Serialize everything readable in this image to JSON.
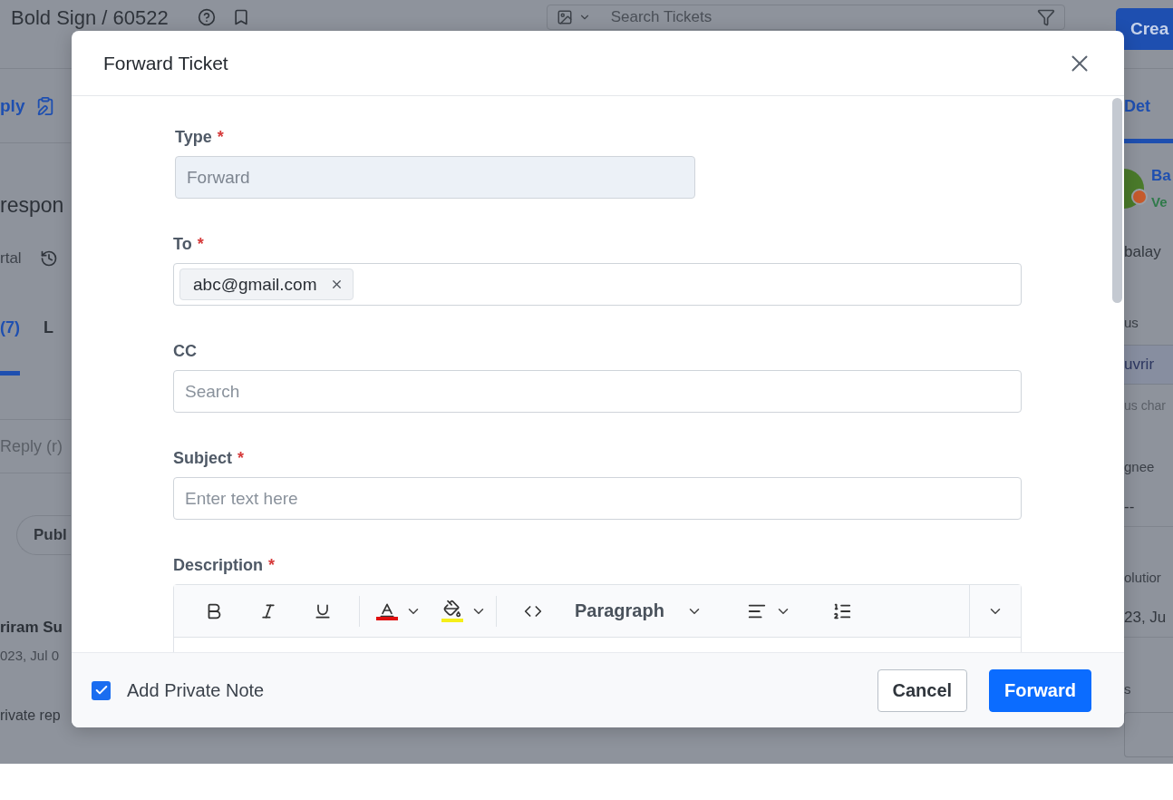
{
  "background": {
    "breadcrumb": "Bold Sign / 60522",
    "search": {
      "placeholder": "Search Tickets"
    },
    "create_button": "Crea",
    "left_items": [
      {
        "kind": "link",
        "text": "ply"
      },
      {
        "kind": "heading",
        "text": "respon"
      },
      {
        "kind": "meta",
        "text": "rtal"
      },
      {
        "kind": "tabs",
        "items": [
          {
            "text": "(7)",
            "selected": true
          },
          {
            "text": "L",
            "selected": false
          }
        ]
      },
      {
        "kind": "field",
        "text": "Reply (r)"
      },
      {
        "kind": "pill",
        "text": "Publ"
      },
      {
        "kind": "name",
        "text": "riram Su"
      },
      {
        "kind": "date",
        "text": "023, Jul 0"
      },
      {
        "kind": "text",
        "text": "rivate rep"
      }
    ],
    "right_items": [
      {
        "kind": "tab",
        "text": "Det",
        "selected": true
      },
      {
        "kind": "contact",
        "name": "Ba",
        "status": "Ve"
      },
      {
        "kind": "text",
        "text": "balay"
      },
      {
        "kind": "label",
        "text": "us"
      },
      {
        "kind": "select",
        "text": "uvrir"
      },
      {
        "kind": "hint",
        "text": "us char"
      },
      {
        "kind": "label",
        "text": "gnee"
      },
      {
        "kind": "value",
        "text": "--"
      },
      {
        "kind": "label",
        "text": "olutior"
      },
      {
        "kind": "value",
        "text": "23, Ju"
      },
      {
        "kind": "label",
        "text": "s"
      },
      {
        "kind": "box"
      }
    ]
  },
  "modal": {
    "title": "Forward Ticket",
    "fields": [
      {
        "kind": "readonly",
        "label": "Type",
        "required": true,
        "value": "Forward"
      },
      {
        "kind": "chips",
        "label": "To",
        "required": true,
        "chips": [
          "abc@gmail.com"
        ]
      },
      {
        "kind": "input",
        "label": "CC",
        "required": false,
        "placeholder": "Search"
      },
      {
        "kind": "input",
        "label": "Subject",
        "required": true,
        "placeholder": "Enter text here"
      },
      {
        "kind": "editor",
        "label": "Description",
        "required": true,
        "block_format": "Paragraph"
      }
    ],
    "required_mark": "*",
    "private_note": {
      "label": "Add Private Note",
      "checked": true
    },
    "buttons": [
      {
        "kind": "secondary",
        "label": "Cancel"
      },
      {
        "kind": "primary",
        "label": "Forward"
      }
    ]
  }
}
